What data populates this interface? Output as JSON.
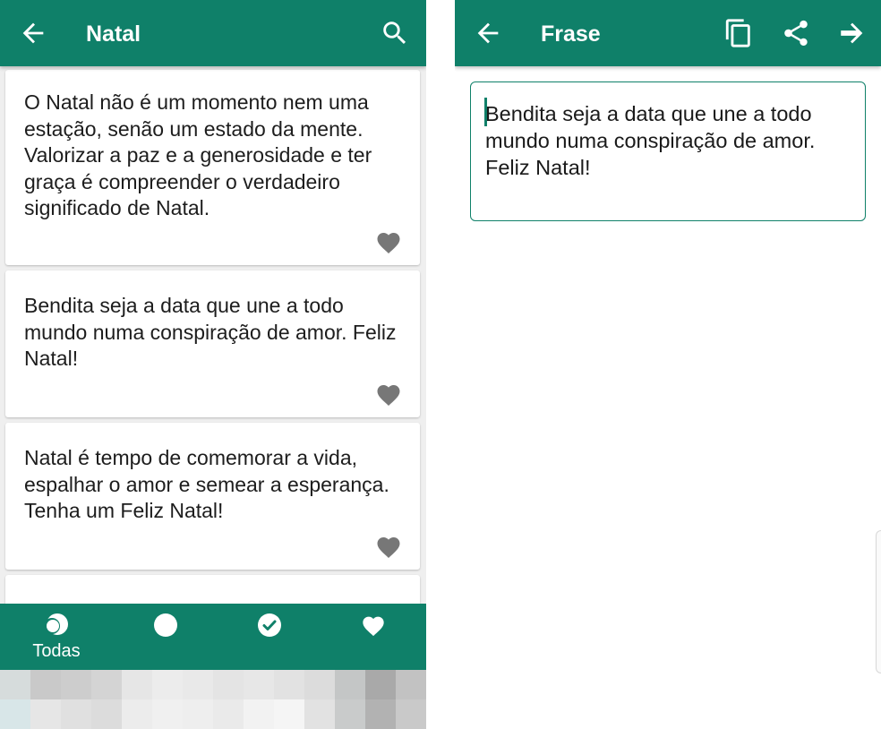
{
  "left_screen": {
    "appbar": {
      "title": "Natal",
      "back_icon": "arrow-left-icon",
      "search_icon": "search-icon"
    },
    "cards": [
      {
        "text": "O Natal não é um momento nem uma estação, senão um estado da mente. Valorizar a paz e a generosidade e ter graça é compreender o verdadeiro significado de Natal."
      },
      {
        "text": "Bendita seja a data que une a todo mundo numa conspiração de amor. Feliz Natal!"
      },
      {
        "text": "Natal é tempo de comemorar a vida, espalhar o amor e semear a esperança. Tenha um Feliz Natal!"
      },
      {
        "text": ""
      }
    ],
    "bottom_nav": [
      {
        "label": "Todas",
        "icon": "half-moon-icon",
        "active": true
      },
      {
        "label": "",
        "icon": "circle-icon",
        "active": false
      },
      {
        "label": "",
        "icon": "check-circle-icon",
        "active": false
      },
      {
        "label": "",
        "icon": "heart-icon",
        "active": false
      }
    ]
  },
  "right_screen": {
    "appbar": {
      "title": "Frase",
      "back_icon": "arrow-left-icon",
      "copy_icon": "copy-icon",
      "share_icon": "share-icon",
      "next_icon": "arrow-right-icon"
    },
    "phrase_text": "Bendita seja a data que une a todo mundo numa conspiração de amor. Feliz Natal!"
  },
  "colors": {
    "primary": "#0f8069",
    "heart": "#777777",
    "card_bg": "#ffffff",
    "list_bg": "#efefef",
    "text": "#1d1d1d"
  },
  "ad_pixels": [
    "#d6dcdc",
    "#c9c9c9",
    "#cdcdcd",
    "#d4d4d4",
    "#e6e6e6",
    "#ececec",
    "#e9e9e9",
    "#e4e4e4",
    "#e7e7e7",
    "#e2e2e2",
    "#dcdcdc",
    "#c4c6c6",
    "#a9a9a9",
    "#c2c2c2",
    "#d8e6e8",
    "#e6e6e6",
    "#e0e0e0",
    "#dcdcdc",
    "#ececec",
    "#f0f0f0",
    "#eeeeee",
    "#eaeaea",
    "#f2f2f2",
    "#f5f5f5",
    "#e2e2e2",
    "#c9cbcb",
    "#b2b2b2",
    "#c9c9c9"
  ]
}
